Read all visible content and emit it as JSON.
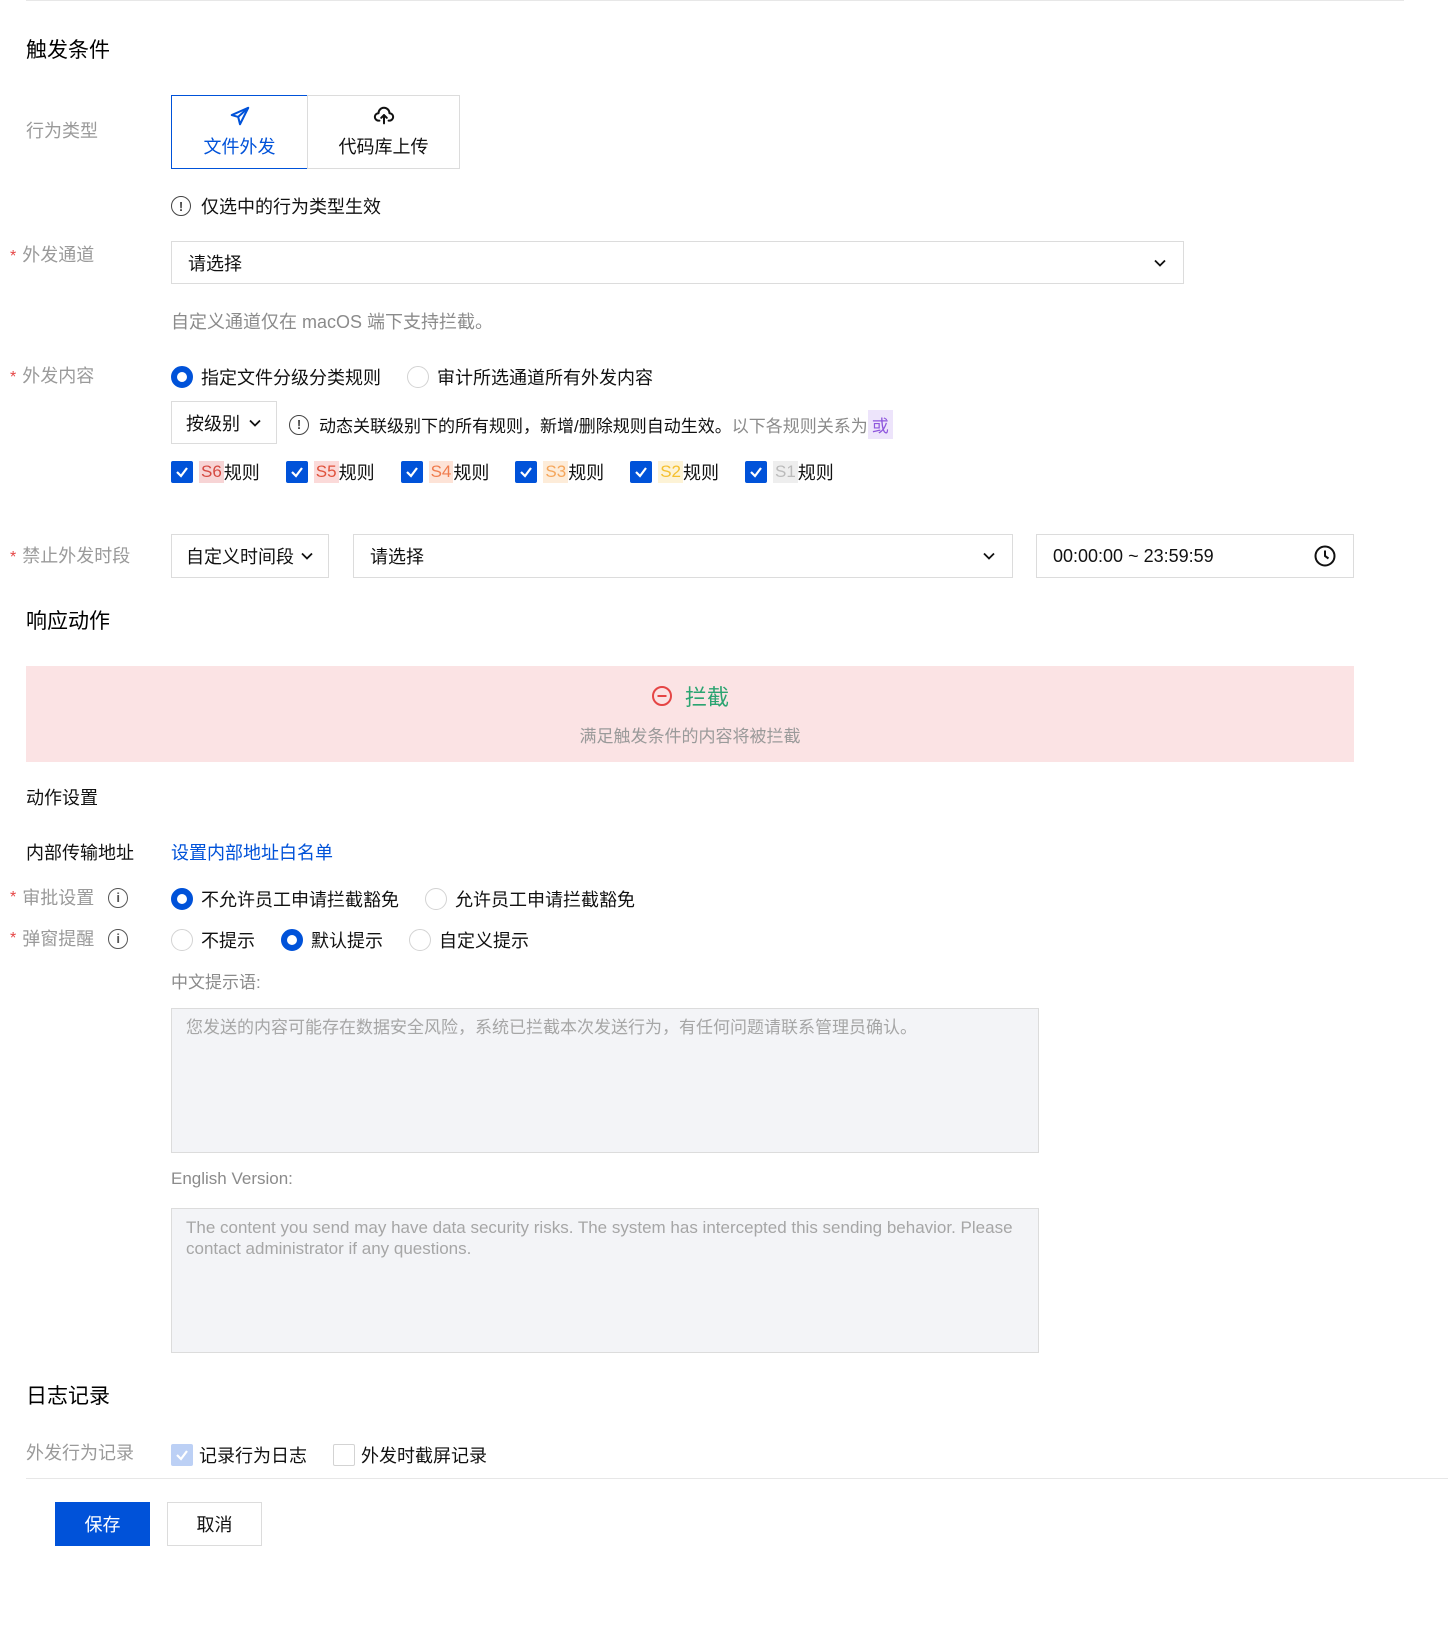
{
  "trigger": {
    "section_title": "触发条件",
    "behavior_type_label": "行为类型",
    "cards": [
      {
        "label": "文件外发",
        "icon": "paper-plane-icon",
        "active": true
      },
      {
        "label": "代码库上传",
        "icon": "cloud-upload-icon",
        "active": false
      }
    ],
    "cards_hint": "仅选中的行为类型生效",
    "channel_label": "外发通道",
    "channel_placeholder": "请选择",
    "channel_note": "自定义通道仅在 macOS 端下支持拦截。",
    "content_label": "外发内容",
    "content_options": [
      {
        "label": "指定文件分级分类规则",
        "checked": true
      },
      {
        "label": "审计所选通道所有外发内容",
        "checked": false
      }
    ],
    "level_select": "按级别",
    "level_hint": "动态关联级别下的所有规则，新增/删除规则自动生效。",
    "level_relation": "以下各规则关系为",
    "level_relation_tag": "或",
    "rules": [
      {
        "tag": "S6",
        "suffix": "规则",
        "color": "#d54941",
        "bg": "#f7d4d5"
      },
      {
        "tag": "S5",
        "suffix": "规则",
        "color": "#e37318",
        "bg": "#fbdcd3"
      },
      {
        "tag": "S4",
        "suffix": "规则",
        "color": "#f07c4d",
        "bg": "#fde3d7"
      },
      {
        "tag": "S3",
        "suffix": "规则",
        "color": "#f5a65b",
        "bg": "#fdecd9"
      },
      {
        "tag": "S2",
        "suffix": "规则",
        "color": "#f5c02f",
        "bg": "#fdf3d6"
      },
      {
        "tag": "S1",
        "suffix": "规则",
        "color": "#bbbbbb",
        "bg": "#eeeeee"
      }
    ],
    "period_label": "禁止外发时段",
    "period_select": "自定义时间段",
    "period_placeholder": "请选择",
    "time_range": "00:00:00 ~ 23:59:59"
  },
  "response": {
    "section_title": "响应动作",
    "block_title": "拦截",
    "block_desc": "满足触发条件的内容将被拦截",
    "action_settings": "动作设置",
    "internal_addr_label": "内部传输地址",
    "internal_addr_link": "设置内部地址白名单",
    "approval_label": "审批设置",
    "approval_options": [
      {
        "label": "不允许员工申请拦截豁免",
        "checked": true
      },
      {
        "label": "允许员工申请拦截豁免",
        "checked": false
      }
    ],
    "popup_label": "弹窗提醒",
    "popup_options": [
      {
        "label": "不提示",
        "checked": false
      },
      {
        "label": "默认提示",
        "checked": true
      },
      {
        "label": "自定义提示",
        "checked": false
      }
    ],
    "cn_label": "中文提示语:",
    "cn_text": "您发送的内容可能存在数据安全风险，系统已拦截本次发送行为，有任何问题请联系管理员确认。",
    "en_label": "English Version:",
    "en_text": "The content you send may have data security risks. The system has intercepted this sending behavior. Please contact administrator if any questions."
  },
  "log": {
    "section_title": "日志记录",
    "record_label": "外发行为记录",
    "options": [
      {
        "label": "记录行为日志",
        "checked": true
      },
      {
        "label": "外发时截屏记录",
        "checked": false
      }
    ]
  },
  "footer": {
    "save": "保存",
    "cancel": "取消"
  },
  "required_mark": "*"
}
